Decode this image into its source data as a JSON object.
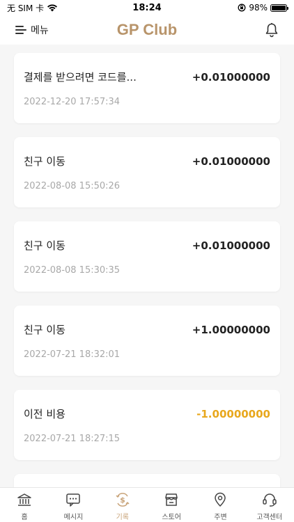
{
  "status_bar": {
    "carrier": "无 SIM 卡",
    "time": "18:24",
    "battery": "98%",
    "battery_level": 0.98
  },
  "header": {
    "menu_label": "메뉴",
    "title": "GP Club"
  },
  "records": [
    {
      "title": "결제를 받으려면 코드를...",
      "amount": "+0.01000000",
      "date": "2022-12-20 17:57:34",
      "negative": false
    },
    {
      "title": "친구 이동",
      "amount": "+0.01000000",
      "date": "2022-08-08 15:50:26",
      "negative": false
    },
    {
      "title": "친구 이동",
      "amount": "+0.01000000",
      "date": "2022-08-08 15:30:35",
      "negative": false
    },
    {
      "title": "친구 이동",
      "amount": "+1.00000000",
      "date": "2022-07-21 18:32:01",
      "negative": false
    },
    {
      "title": "이전 비용",
      "amount": "-1.00000000",
      "date": "2022-07-21 18:27:15",
      "negative": true
    },
    {
      "title": "",
      "amount": "",
      "date": "",
      "negative": false
    }
  ],
  "tabs": [
    {
      "label": "홈",
      "icon": "bank-icon",
      "active": false
    },
    {
      "label": "메시지",
      "icon": "message-icon",
      "active": false
    },
    {
      "label": "기록",
      "icon": "dollar-refresh-icon",
      "active": true
    },
    {
      "label": "스토어",
      "icon": "store-icon",
      "active": false
    },
    {
      "label": "주변",
      "icon": "location-icon",
      "active": false
    },
    {
      "label": "고객센터",
      "icon": "headset-icon",
      "active": false
    }
  ],
  "colors": {
    "brand": "#b8946a",
    "negative": "#e8a71c",
    "active_tab": "#c9a47a"
  }
}
